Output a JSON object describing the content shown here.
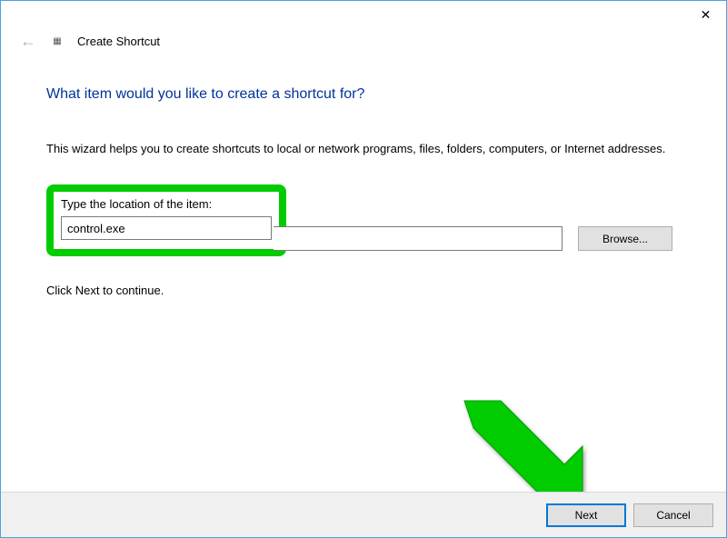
{
  "titlebar": {
    "close_glyph": "✕"
  },
  "header": {
    "back_glyph": "←",
    "icon_glyph": "▦",
    "title": "Create Shortcut"
  },
  "content": {
    "heading": "What item would you like to create a shortcut for?",
    "description": "This wizard helps you to create shortcuts to local or network programs, files, folders, computers, or Internet addresses.",
    "location_label": "Type the location of the item:",
    "location_value": "control.exe",
    "browse_label": "Browse...",
    "continue_text": "Click Next to continue."
  },
  "footer": {
    "next_label": "Next",
    "cancel_label": "Cancel"
  },
  "annotations": {
    "highlight_color": "#00cc00",
    "arrow_color": "#00cc00"
  }
}
